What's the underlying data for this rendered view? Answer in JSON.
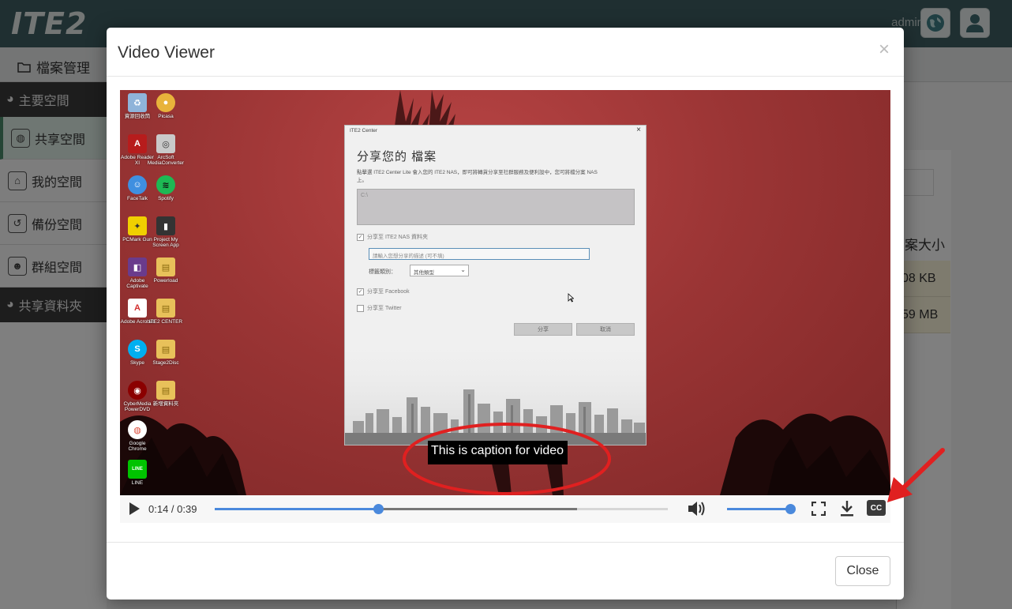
{
  "app": {
    "logo": "ITE2",
    "user_name": "admin",
    "section_title": "檔案管理",
    "sidebar": {
      "main_section": "主要空間",
      "items": [
        {
          "label": "共享空間",
          "icon": "globe-icon"
        },
        {
          "label": "我的空間",
          "icon": "home-icon"
        },
        {
          "label": "備份空間",
          "icon": "history-icon"
        },
        {
          "label": "群組空間",
          "icon": "group-icon"
        }
      ],
      "shared_section": "共享資料夾"
    },
    "content": {
      "size_header": "案大小",
      "rows": [
        "08 KB",
        "59 MB"
      ]
    }
  },
  "modal": {
    "title": "Video Viewer",
    "close_x": "×",
    "close_button": "Close"
  },
  "video": {
    "caption": "This is caption for video",
    "current_time": "0:14",
    "duration": "0:39",
    "time_display": "0:14 / 0:39",
    "progress_fraction": 0.36,
    "buffered_fraction": 0.8,
    "volume_fraction": 1.0,
    "cc_label": "CC",
    "desktop_icons": [
      {
        "label": "資源回收筒",
        "color": "#8fb3d9",
        "glyph": "♻"
      },
      {
        "label": "Picasa",
        "color": "#e8b33b",
        "glyph": "●"
      },
      {
        "label": "Adobe Reader XI",
        "color": "#b71c1c",
        "glyph": "A"
      },
      {
        "label": "ArcSoft MediaConverter",
        "color": "#c9c9c9",
        "glyph": "◎"
      },
      {
        "label": "FaceTalk",
        "color": "#3f8fe0",
        "glyph": "☺"
      },
      {
        "label": "Spotify",
        "color": "#1db954",
        "glyph": "≋"
      },
      {
        "label": "PCMark Gun",
        "color": "#f0d000",
        "glyph": "✦"
      },
      {
        "label": "Project My Screen App",
        "color": "#333333",
        "glyph": "▮"
      },
      {
        "label": "Adobe Captivate",
        "color": "#6a3b8c",
        "glyph": "◧"
      },
      {
        "label": "Powerload",
        "color": "#e8c15a",
        "glyph": "▤"
      },
      {
        "label": "Adobe Acrobat",
        "color": "#d32f2f",
        "glyph": "A"
      },
      {
        "label": "ITE2 CENTER",
        "color": "#e8c15a",
        "glyph": "▤"
      },
      {
        "label": "Skype",
        "color": "#00aff0",
        "glyph": "S"
      },
      {
        "label": "Stage2Disc",
        "color": "#e8c15a",
        "glyph": "▤"
      },
      {
        "label": "CyberMedia PowerDVD",
        "color": "#8b0000",
        "glyph": "◉"
      },
      {
        "label": "新增資料夾",
        "color": "#e8c15a",
        "glyph": "▤"
      },
      {
        "label": "Google Chrome",
        "color": "#dd4b39",
        "glyph": "◍"
      },
      {
        "label": "LINE",
        "color": "#00c300",
        "glyph": "LINE"
      }
    ],
    "inner_window": {
      "title": "ITE2 Center",
      "close": "×",
      "heading": "分享您的 檔案",
      "description": "點擊選 ITE2 Center Lite 會入您的 ITE2 NAS，即可將轉貨分享至社群服務及便利設中，您可將檔分案 NAS 上。",
      "textarea_text": "C:\\",
      "checkbox_nas": "分享至 ITE2 NAS 資料夾",
      "input_placeholder": "請輸入您想分享的描述 (可不填)",
      "category_label": "標籤類別：",
      "category_value": "其他類型",
      "checkbox_facebook": "分享至 Facebook",
      "checkbox_twitter": "分享至 Twitter",
      "btn_share": "分享",
      "btn_cancel": "取消"
    }
  },
  "annotation": {
    "highlight_color": "#e02020"
  }
}
